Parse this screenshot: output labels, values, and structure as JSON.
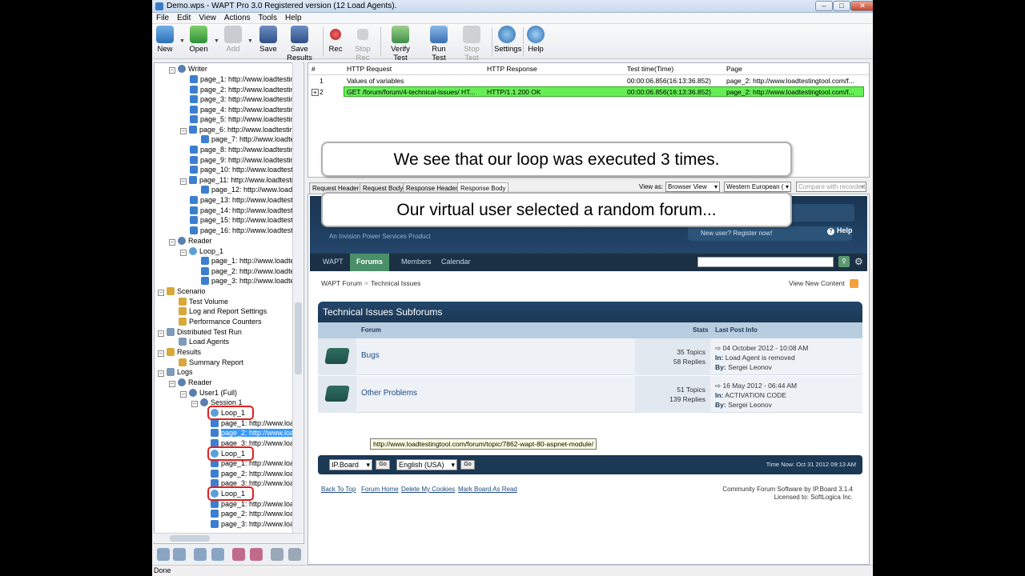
{
  "window": {
    "title": "Demo.wps - WAPT Pro 3.0 Registered version (12 Load Agents)."
  },
  "menu": [
    "File",
    "Edit",
    "View",
    "Actions",
    "Tools",
    "Help"
  ],
  "toolbar": {
    "new": "New",
    "open": "Open",
    "add": "Add",
    "save": "Save",
    "save_results": "Save Results",
    "rec": "Rec",
    "stop_rec": "Stop Rec",
    "verify_test": "Verify Test",
    "run_test": "Run Test",
    "stop_test": "Stop Test",
    "settings": "Settings",
    "help": "Help"
  },
  "tree": {
    "writer": "Writer",
    "writer_pages": [
      "page_1: http://www.loadtesting",
      "page_2: http://www.loadtesting",
      "page_3: http://www.loadtesting",
      "page_4: http://www.loadtesting",
      "page_5: http://www.loadtesting",
      "page_6: http://www.loadtesting",
      "page_7: http://www.loadtes",
      "page_8: http://www.loadtesting",
      "page_9: http://www.loadtesting",
      "page_10: http://www.loadtestin",
      "page_11: http://www.loadtestin",
      "page_12: http://www.loadte",
      "page_13: http://www.loadtestin",
      "page_14: http://www.loadtestin",
      "page_15: http://www.loadtestin",
      "page_16: http://www.loadtestin"
    ],
    "reader": "Reader",
    "loop": "Loop_1",
    "reader_pages": [
      "page_1: http://www.loadtes",
      "page_2: http://www.loadtes",
      "page_3: http://www.loadtes"
    ],
    "scenario": "Scenario",
    "test_volume": "Test Volume",
    "log_report": "Log and Report Settings",
    "perf_counters": "Performance Counters",
    "distributed": "Distributed Test Run",
    "load_agents": "Load Agents",
    "results": "Results",
    "summary_report": "Summary Report",
    "logs": "Logs",
    "logs_reader": "Reader",
    "user1": "User1 (Full)",
    "session": "Session 1",
    "log_page1": "page_1: http://www.load",
    "log_page2": "page_2: http://www.load",
    "log_page3": "page_3: http://www.load",
    "tooltip": "http://www.loadtestingtool.com/forum/topic/7862-wapt-80-aspnet-module/"
  },
  "grid": {
    "columns": [
      "#",
      "HTTP Request",
      "HTTP Response",
      "Test time(Time)",
      "Page"
    ],
    "rows": [
      {
        "num": "1",
        "request": "Values of variables",
        "response": "",
        "time": "00:00:06.856(16:13:36.852)",
        "page": "page_2: http://www.loadtestingtool.com/f..."
      },
      {
        "num": "2",
        "request": "GET /forum/forum/4-technical-issues/ HT...",
        "response": "HTTP/1.1 200 OK",
        "time": "00:00:06.856(16:13:36.852)",
        "page": "page_2: http://www.loadtestingtool.com/f..."
      }
    ]
  },
  "callouts": {
    "top": "We see that our loop was executed 3 times.",
    "bottom": "Our virtual user selected a random forum..."
  },
  "tabs": [
    "Request Header",
    "Request Body",
    "Response Header",
    "Response Body"
  ],
  "view_as_label": "View as:",
  "view_as_value": "Browser View",
  "encoding_value": "Western European (",
  "compare_button": "Compare with recorded",
  "forum": {
    "tagline": "An Invision Power Services Product",
    "register": "New user? Register now!",
    "help": "Help",
    "nav": [
      "WAPT",
      "Forums",
      "Members",
      "Calendar"
    ],
    "breadcrumb_home": "WAPT Forum",
    "breadcrumb_sep": ">",
    "breadcrumb_current": "Technical Issues",
    "view_new": "View New Content",
    "category_title": "Technical Issues Subforums",
    "col_forum": "Forum",
    "col_stats": "Stats",
    "col_last": "Last Post Info",
    "forums": [
      {
        "name": "Bugs",
        "topics": "35 Topics",
        "replies": "58 Replies",
        "date": "04 October 2012 - 10:08 AM",
        "in_label": "In:",
        "in": "Load Agent is removed",
        "by_label": "By:",
        "by": "Sergei Leonov"
      },
      {
        "name": "Other Problems",
        "topics": "51 Topics",
        "replies": "139 Replies",
        "date": "16 May 2012 - 06:44 AM",
        "in_label": "In:",
        "in": "ACTIVATION CODE",
        "by_label": "By:",
        "by": "Sergei Leonov"
      }
    ],
    "skin": "IP.Board",
    "lang": "English (USA)",
    "go": "Go",
    "time_now": "Time Now: Oct 31 2012 09:13 AM",
    "footer_links": [
      "Back To Top",
      "Forum Home",
      "Delete My Cookies",
      "Mark Board As Read"
    ],
    "powered": "Community Forum Software by IP.Board 3.1.4",
    "licensed": "Licensed to: SoftLogica Inc."
  },
  "status": "Done"
}
